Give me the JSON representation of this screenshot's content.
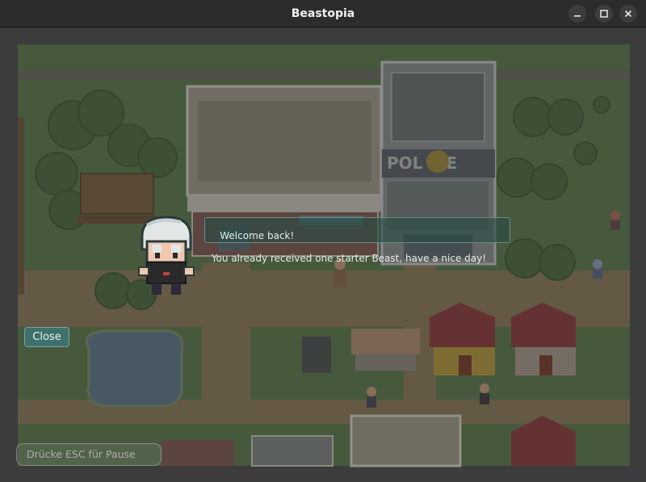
{
  "window": {
    "title": "Beastopia",
    "controls": [
      "minimize-icon",
      "maximize-icon",
      "close-icon"
    ]
  },
  "dialog": {
    "line1": "Welcome back!",
    "line2": " You already received one starter Beast, have a nice day!"
  },
  "close_button": {
    "label": "Close"
  },
  "hint": {
    "text": "Drücke ESC für Pause"
  },
  "map": {
    "police_sign": "POL ICE"
  },
  "colors": {
    "grass": "#5d7a4d",
    "path": "#8a7a58",
    "water": "#5e7a8c",
    "dialog_bg": "#284b46",
    "button": "#3f716c",
    "roof_red": "#8c3a3a",
    "title_bar": "#2c2c2c"
  }
}
